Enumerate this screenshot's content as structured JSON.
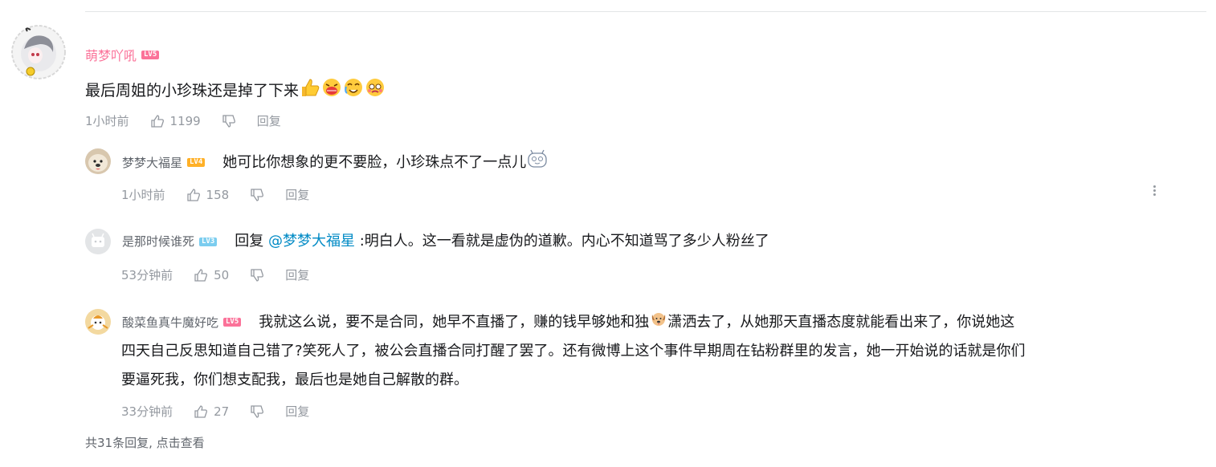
{
  "root_comment": {
    "username": "萌梦吖吼",
    "level": "LV5",
    "content": "最后周姐的小珍珠还是掉了下来",
    "emojis": [
      "thumbs-up-icon",
      "grimace-emoji-icon",
      "crying-emoji-icon",
      "pleading-emoji-icon"
    ],
    "time": "1小时前",
    "likes": "1199",
    "reply_label": "回复"
  },
  "replies": [
    {
      "username": "梦梦大福星",
      "level": "LV4",
      "content": "她可比你想象的更不要脸，小珍珠点不了一点儿",
      "trailing_emoji": "robot-face-emoji-icon",
      "time": "1小时前",
      "likes": "158",
      "reply_label": "回复"
    },
    {
      "username": "是那时候谁死",
      "level": "LV3",
      "reply_prefix": "回复 ",
      "mention": "@梦梦大福星",
      "content": " :明白人。这一看就是虚伪的道歉。内心不知道骂了多少人粉丝了",
      "time": "53分钟前",
      "likes": "50",
      "reply_label": "回复"
    },
    {
      "username": "酸菜鱼真牛魔好吃",
      "level": "LV5",
      "content_part1": "我就这么说，要不是合同，她早不直播了，赚的钱早够她和独",
      "content_part2": "潇洒去了，从她那天直播态度就能看出来了，你说她这",
      "content_line2": "四天自己反思知道自己错了?笑死人了，被公会直播合同打醒了罢了。还有微博上这个事件早期周在钻粉群里的发言，她一开始说的话就是你们",
      "content_line3": "要逼死我，你们想支配我，最后也是她自己解散的群。",
      "inline_emoji": "dog-emoji-icon",
      "time": "33分钟前",
      "likes": "27",
      "reply_label": "回复"
    }
  ],
  "view_more": "共31条回复, 点击查看",
  "colors": {
    "vip_name": "#fb7299",
    "mention": "#008ac5",
    "meta_gray": "#9499a0",
    "lv3": "#7bcdef",
    "lv4": "#ffb027",
    "lv5": "#fb7299"
  }
}
